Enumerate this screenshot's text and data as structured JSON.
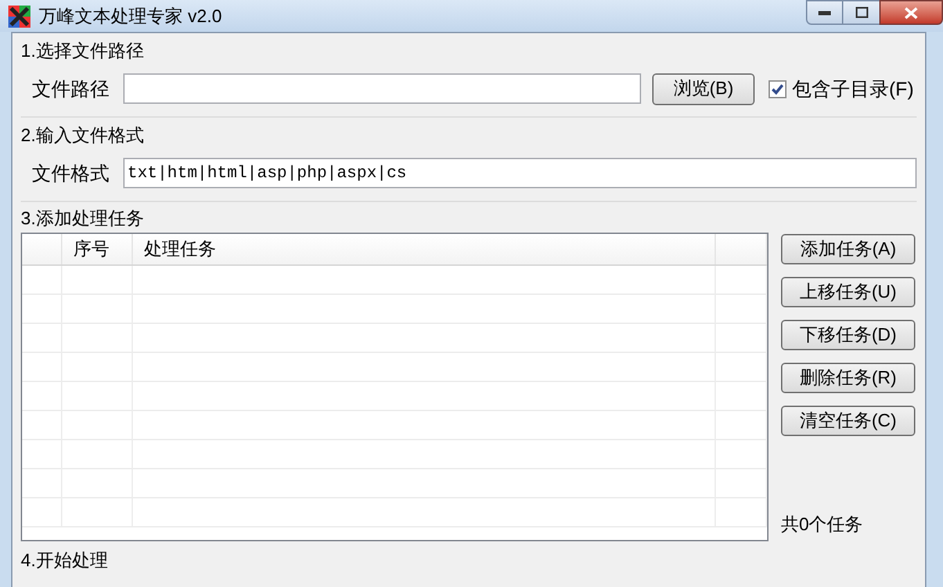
{
  "window": {
    "title": "万峰文本处理专家 v2.0"
  },
  "section_1": {
    "title": "1.选择文件路径",
    "path_label": "文件路径",
    "browse_button": "浏览(B)",
    "include_subdirs": {
      "label": "包含子目录(F)",
      "checked": true
    }
  },
  "section_2": {
    "title": "2.输入文件格式",
    "format_label": "文件格式",
    "format_value": "txt|htm|html|asp|php|aspx|cs"
  },
  "section_3": {
    "title": "3.添加处理任务",
    "table": {
      "columns": [
        "",
        "序号",
        "处理任务",
        ""
      ]
    },
    "buttons": [
      "添加任务(A)",
      "上移任务(U)",
      "下移任务(D)",
      "删除任务(R)",
      "清空任务(C)"
    ],
    "count": "共0个任务"
  },
  "section_4": {
    "title": "4.开始处理"
  }
}
